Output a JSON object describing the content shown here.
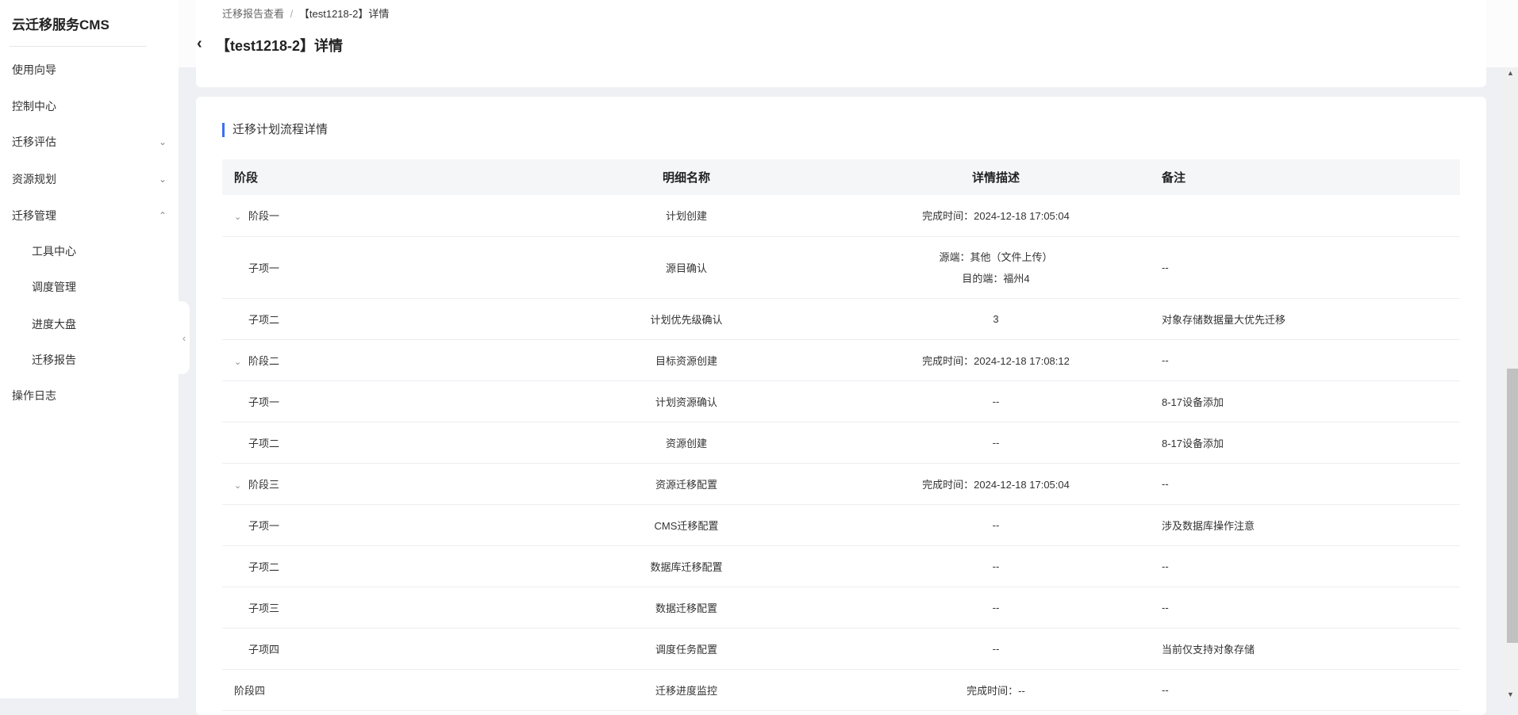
{
  "sidebar": {
    "brand": "云迁移服务CMS",
    "items": [
      {
        "label": "使用向导"
      },
      {
        "label": "控制中心"
      },
      {
        "label": "迁移评估"
      },
      {
        "label": "资源规划"
      },
      {
        "label": "迁移管理"
      },
      {
        "label": "工具中心"
      },
      {
        "label": "调度管理"
      },
      {
        "label": "进度大盘"
      },
      {
        "label": "迁移报告"
      },
      {
        "label": "操作日志"
      }
    ]
  },
  "header": {
    "breadcrumb": [
      "迁移报告查看",
      "【test1218-2】详情"
    ],
    "separator": "/",
    "title": "【test1218-2】详情"
  },
  "section": {
    "title": "迁移计划流程详情"
  },
  "table": {
    "columns": [
      "阶段",
      "明细名称",
      "详情描述",
      "备注"
    ],
    "rows": [
      {
        "stage": "阶段一",
        "name": "计划创建",
        "desc": "完成时间：2024-12-18 17:05:04",
        "note": ""
      },
      {
        "stage": "子项一",
        "name": "源目确认",
        "desc": "源端：其他（文件上传）",
        "desc2": "目的端：福州4",
        "note": "--"
      },
      {
        "stage": "子项二",
        "name": "计划优先级确认",
        "desc": "3",
        "note": "对象存储数据量大优先迁移"
      },
      {
        "stage": "阶段二",
        "name": "目标资源创建",
        "desc": "完成时间：2024-12-18 17:08:12",
        "note": "--"
      },
      {
        "stage": "子项一",
        "name": "计划资源确认",
        "desc": "--",
        "note": "8-17设备添加"
      },
      {
        "stage": "子项二",
        "name": "资源创建",
        "desc": "--",
        "note": "8-17设备添加"
      },
      {
        "stage": "阶段三",
        "name": "资源迁移配置",
        "desc": "完成时间：2024-12-18 17:05:04",
        "note": "--"
      },
      {
        "stage": "子项一",
        "name": "CMS迁移配置",
        "desc": "--",
        "note": "涉及数据库操作注意"
      },
      {
        "stage": "子项二",
        "name": "数据库迁移配置",
        "desc": "--",
        "note": "--"
      },
      {
        "stage": "子项三",
        "name": "数据迁移配置",
        "desc": "--",
        "note": "--"
      },
      {
        "stage": "子项四",
        "name": "调度任务配置",
        "desc": "--",
        "note": "当前仅支持对象存储"
      },
      {
        "stage": "阶段四",
        "name": "迁移进度监控",
        "desc": "完成时间：--",
        "note": "--"
      }
    ]
  },
  "colors": {
    "accent": "#3a6ff7"
  }
}
